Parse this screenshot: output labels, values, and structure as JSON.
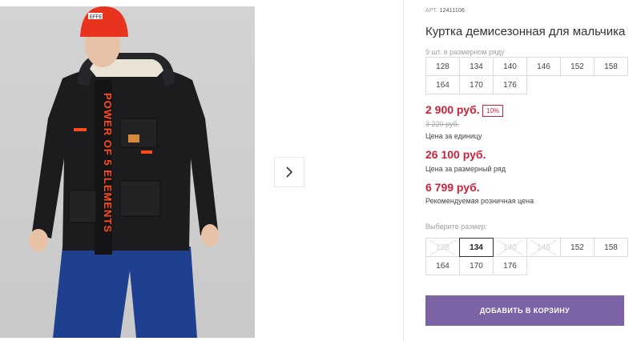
{
  "product": {
    "article_label": "АРТ.",
    "article": "12411106",
    "title": "Куртка демисезонная для мальчика",
    "range_note": "9 шт. в размерном ряду",
    "range_sizes": [
      "128",
      "134",
      "140",
      "146",
      "152",
      "158",
      "164",
      "170",
      "176"
    ],
    "price": "2 900 руб.",
    "discount": "10%",
    "old_price": "3 220 руб.",
    "price_caption": "Цена за единицу",
    "range_price": "26 100 руб.",
    "range_price_caption": "Цена за размерный ряд",
    "rrp": "6 799 руб.",
    "rrp_caption": "Рекомендуемая розничная цена",
    "choose_size_label": "Выберите размер:",
    "sizes": [
      {
        "label": "128",
        "available": false
      },
      {
        "label": "134",
        "available": true,
        "selected": true
      },
      {
        "label": "140",
        "available": false
      },
      {
        "label": "146",
        "available": false
      },
      {
        "label": "152",
        "available": true
      },
      {
        "label": "158",
        "available": true
      },
      {
        "label": "164",
        "available": true
      },
      {
        "label": "170",
        "available": true
      },
      {
        "label": "176",
        "available": true
      }
    ],
    "add_to_cart": "ДОБАВИТЬ В КОРЗИНУ"
  },
  "photo": {
    "jacket_print": "POWER OF 5 ELEMENTS",
    "hat_patch": "EFFE"
  },
  "icons": {
    "next": "chevron-right-icon"
  },
  "colors": {
    "price_red": "#d0213b",
    "button_purple": "#7b63a6",
    "jacket": "#1c1c1f",
    "hat": "#e8341f",
    "pants": "#1f3f8f",
    "accent_orange": "#ff4a1c"
  }
}
